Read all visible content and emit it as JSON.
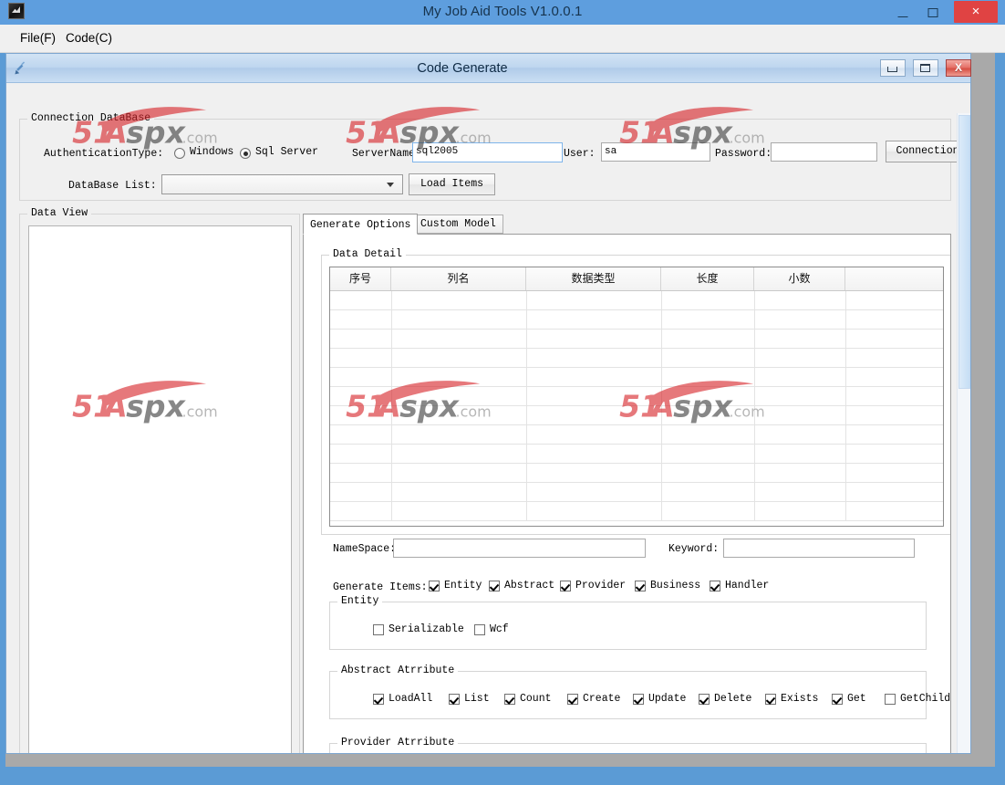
{
  "window": {
    "title": "My Job Aid Tools V1.0.0.1",
    "icon": "app-icon",
    "minimize_label": "–",
    "maximize_label": "□",
    "close_label": "×"
  },
  "menubar": {
    "items": [
      {
        "label": "File(F)",
        "name": "menu-file"
      },
      {
        "label": "Code(C)",
        "name": "menu-code"
      }
    ]
  },
  "child_window": {
    "title": "Code Generate",
    "minimize_label": "",
    "maximize_label": "",
    "close_label": "X"
  },
  "connection_group": {
    "title": "Connection DataBase",
    "auth_label": "AuthenticationType:",
    "radio_windows": "Windows",
    "radio_sqlserver": "Sql Server",
    "radio_selected": "Sql Server",
    "servername_label": "ServerName:",
    "servername_value": "sql2005",
    "user_label": "User:",
    "user_value": "sa",
    "password_label": "Password:",
    "password_value": "",
    "connection_button": "Connection",
    "dblist_label": "DataBase List:",
    "dblist_value": "",
    "load_items_button": "Load Items"
  },
  "dataview_group": {
    "title": "Data View",
    "content": ""
  },
  "tabs": [
    {
      "label": "Generate Options",
      "active": true
    },
    {
      "label": "Custom Model",
      "active": false
    }
  ],
  "data_detail": {
    "title": "Data Detail",
    "columns": [
      "序号",
      "列名",
      "数据类型",
      "长度",
      "小数",
      ""
    ],
    "rows": []
  },
  "fields": {
    "namespace_label": "NameSpace:",
    "namespace_value": "",
    "keyword_label": "Keyword:",
    "keyword_value": ""
  },
  "generate_items": {
    "label": "Generate Items:",
    "items": [
      {
        "label": "Entity",
        "checked": true
      },
      {
        "label": "Abstract",
        "checked": true
      },
      {
        "label": "Provider",
        "checked": true
      },
      {
        "label": "Business",
        "checked": true
      },
      {
        "label": "Handler",
        "checked": true
      }
    ]
  },
  "entity_group": {
    "title": "Entity",
    "items": [
      {
        "label": "Serializable",
        "checked": false
      },
      {
        "label": "Wcf",
        "checked": false
      }
    ]
  },
  "abstract_group": {
    "title": "Abstract Atrribute",
    "items": [
      {
        "label": "LoadAll",
        "checked": true
      },
      {
        "label": "List",
        "checked": true
      },
      {
        "label": "Count",
        "checked": true
      },
      {
        "label": "Create",
        "checked": true
      },
      {
        "label": "Update",
        "checked": true
      },
      {
        "label": "Delete",
        "checked": true
      },
      {
        "label": "Exists",
        "checked": true
      },
      {
        "label": "Get",
        "checked": true
      },
      {
        "label": "GetChild",
        "checked": false
      }
    ]
  },
  "provider_group": {
    "title": "Provider Atrribute",
    "items": []
  },
  "watermark": {
    "text_51": "51",
    "text_a": "A",
    "text_spx": "spx",
    "text_com": ".com",
    "color_red": "#D7262B",
    "color_dark": "#3F3F3F",
    "color_gray": "#8C8C8C"
  }
}
